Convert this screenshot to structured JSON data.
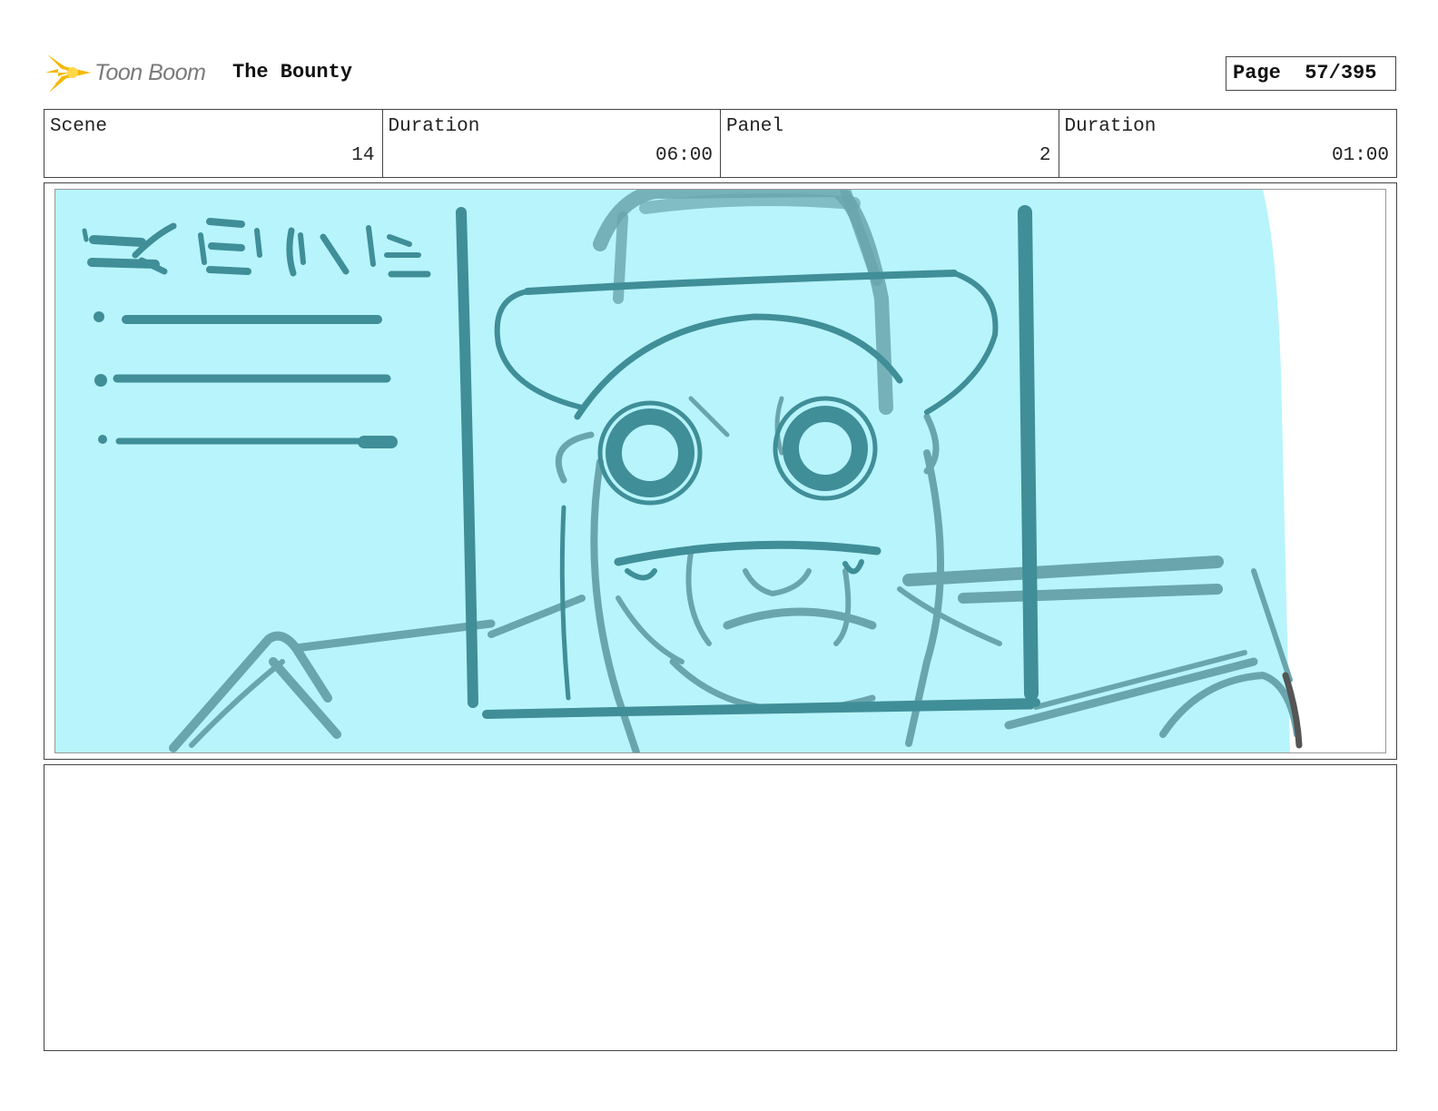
{
  "header": {
    "logo_text": "Toon Boom",
    "logo_icon": "starburst-icon",
    "project_title": "The Bounty",
    "page_label": "Page",
    "page_value": "57/395"
  },
  "info": {
    "scene_label": "Scene",
    "scene_value": "14",
    "scene_duration_label": "Duration",
    "scene_duration_value": "06:00",
    "panel_label": "Panel",
    "panel_value": "2",
    "panel_duration_label": "Duration",
    "panel_duration_value": "01:00"
  },
  "colors": {
    "accent": "#f5b800",
    "sketch_fill": "#b8f4fc",
    "sketch_line": "#3f8e98",
    "sketch_line_light": "#6aa5ad"
  },
  "notes": {
    "text": ""
  }
}
